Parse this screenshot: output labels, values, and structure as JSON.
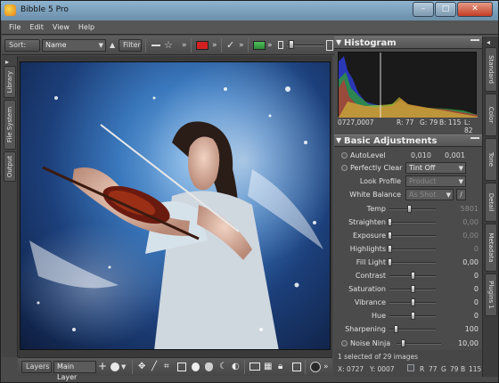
{
  "window": {
    "title": "Bibble 5 Pro",
    "controls": {
      "minimize": "–",
      "maximize": "□",
      "close": "✕"
    }
  },
  "menu": [
    "File",
    "Edit",
    "View",
    "Help"
  ],
  "toolbar": {
    "sort_label": "Sort:",
    "sort_value": "Name",
    "filter_label": "Filter",
    "colors": {
      "red_label": "#d42020",
      "green_label": "#3fa84a"
    }
  },
  "left_tabs": [
    "Library",
    "File System",
    "Output"
  ],
  "right_tabs": [
    "Standard",
    "Color",
    "Tone",
    "Detail",
    "Metadata",
    "Plugins 1"
  ],
  "histogram": {
    "title": "Histogram",
    "coords": "0727,0007",
    "r": "R: 77",
    "g": "G: 79",
    "b": "B: 115",
    "l": "L: 82"
  },
  "basic": {
    "title": "Basic Adjustments",
    "autolevel_label": "AutoLevel",
    "autolevel_v1": "0,010",
    "autolevel_v2": "0,001",
    "perfectly_clear_label": "Perfectly Clear",
    "perfectly_clear_value": "Tint Off",
    "look_profile_label": "Look Profile",
    "look_profile_value": "Product",
    "white_balance_label": "White Balance",
    "white_balance_value": "As Shot",
    "sliders": [
      {
        "label": "Temp",
        "value": "5801",
        "level": 0.42,
        "dim": true
      },
      {
        "label": "Straighten",
        "value": "0,00",
        "level": 0.0,
        "dim": true
      },
      {
        "label": "Exposure",
        "value": "0,00",
        "level": 0.0,
        "dim": true
      },
      {
        "label": "Highlights",
        "value": "0",
        "level": 0.0,
        "dim": true
      },
      {
        "label": "Fill Light",
        "value": "0,00",
        "level": 0.0,
        "dim": false
      },
      {
        "label": "Contrast",
        "value": "0",
        "level": 0.5,
        "dim": false
      },
      {
        "label": "Saturation",
        "value": "0",
        "level": 0.5,
        "dim": false
      },
      {
        "label": "Vibrance",
        "value": "0",
        "level": 0.5,
        "dim": false
      },
      {
        "label": "Hue",
        "value": "0",
        "level": 0.5,
        "dim": false
      },
      {
        "label": "Sharpening",
        "value": "100",
        "level": 0.14,
        "dim": false
      }
    ],
    "noise_ninja_label": "Noise Ninja",
    "noise_ninja_value": "10,00"
  },
  "bottom_toolbar": {
    "layers_label": "Layers",
    "layer_value": "Main Layer"
  },
  "status": {
    "selection": "1 selected of 29 images",
    "x": "X: 0727",
    "y": "Y: 0007",
    "r": "R",
    "r_val": "77",
    "g": "G",
    "g_val": "79",
    "b": "B",
    "b_val": "115"
  }
}
